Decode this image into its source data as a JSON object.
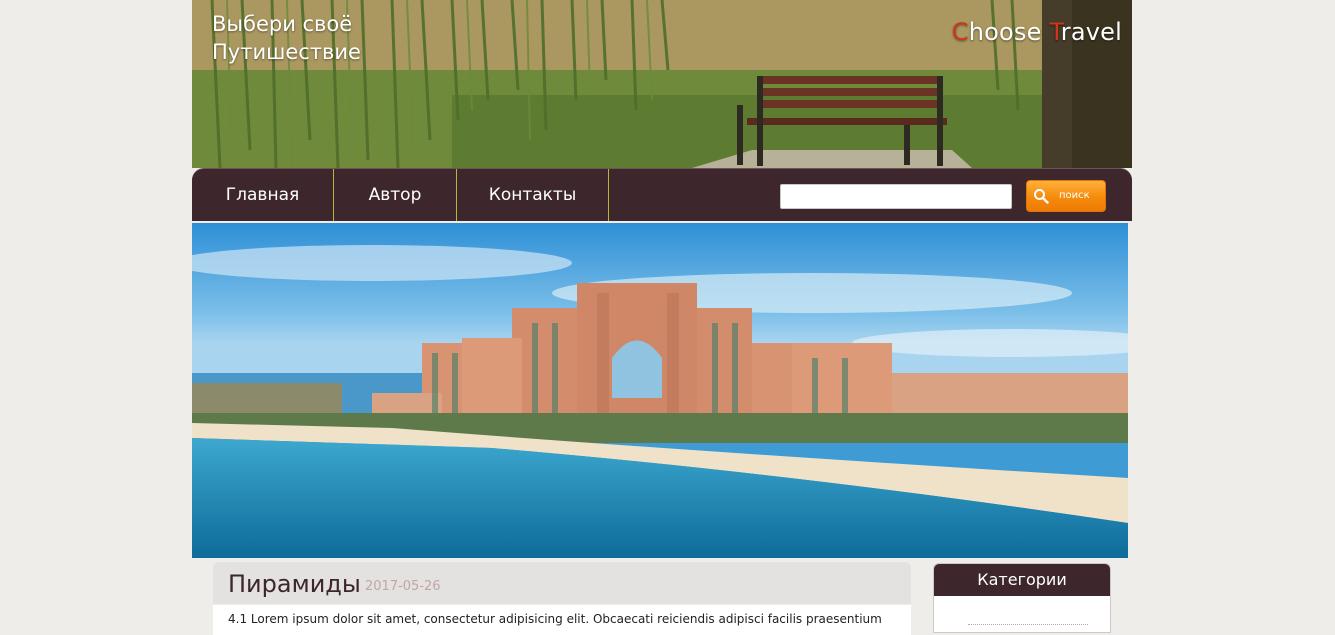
{
  "header": {
    "slogan_line1": "Выбери своё",
    "slogan_line2": "Путишествие",
    "logo_part1_accent": "C",
    "logo_part1": "hoose ",
    "logo_part2_accent": "T",
    "logo_part2": "ravel"
  },
  "nav": {
    "items": [
      {
        "label": "Главная"
      },
      {
        "label": "Автор"
      },
      {
        "label": "Контакты"
      }
    ],
    "search_placeholder": "",
    "search_button_label": "поиск"
  },
  "post": {
    "title": "Пирамиды",
    "date": "2017-05-26",
    "text": "4.1 Lorem ipsum dolor sit amet, consectetur adipisicing elit. Obcaecati reiciendis adipisci facilis praesentium"
  },
  "sidebar": {
    "heading": "Категории"
  },
  "colors": {
    "nav_bg": "#3d272c",
    "nav_divider": "#bfb23a",
    "logo_accent": "#d0341b",
    "search_button": "#f58b0c",
    "page_bg": "#eeede9",
    "date_text": "#c1a7a3"
  },
  "icons": {
    "search_button_icon": "magnifier-icon"
  }
}
